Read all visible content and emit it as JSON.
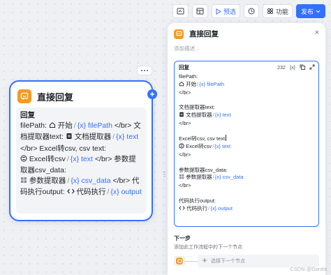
{
  "toolbar": {
    "run_label": "预选",
    "features_label": "功能",
    "publish_label": "发布"
  },
  "node": {
    "title": "直接回复",
    "content_label": "回复",
    "line1_text": "filePath:",
    "start_chip": {
      "node": "开始",
      "var_prefix": "{x}",
      "var": "filePath"
    },
    "line2_text": "</br> 文档提取器text:",
    "doc_chip": {
      "node": "文档提取器",
      "var_prefix": "{x}",
      "var": "text"
    },
    "line3_text": "</br> Excel转csv, csv text:",
    "excel_chip": {
      "node": "Excel转csv",
      "var_prefix": "{x}",
      "var": "text"
    },
    "line4_text": "</br> 参数提取器csv_data:",
    "param_chip": {
      "node": "参数提取器",
      "var_prefix": "{x}",
      "var": "csv_data"
    },
    "line5_text": "</br> 代码执行output:",
    "code_chip": {
      "node": "代码执行",
      "var_prefix": "{x}",
      "var": "output"
    }
  },
  "panel": {
    "title": "直接回复",
    "close_label": "×",
    "description_placeholder": "添加描述...",
    "editor": {
      "label": "回复",
      "count": "232",
      "var_button": "{x}",
      "lines": {
        "l1": "filePath:",
        "l1_node": "开始",
        "l1_var": "filePath",
        "l2": "</br>",
        "l3": "文档提取器text:",
        "l3_node": "文档提取器",
        "l3_var": "text",
        "l4": "</br>",
        "l5": "Excel转csv, csv text",
        "l5_node": "Excel转csv",
        "l5_var": "text",
        "l6": "</br>",
        "l7": "参数提取器csv_data:",
        "l7_node": "参数提取器",
        "l7_var": "csv_data",
        "l8": "</br>",
        "l9": "代码执行output:",
        "l9_node": "代码执行",
        "l9_var": "output",
        "var_prefix": "{x}"
      }
    },
    "next": {
      "title": "下一步",
      "description": "添加此工作流程中的下一个节点",
      "select_placeholder": "选择下一个节点"
    }
  },
  "watermark": "CSDN @Dontla",
  "colors": {
    "accent": "#3370ff",
    "node_icon": "#f59a23"
  }
}
